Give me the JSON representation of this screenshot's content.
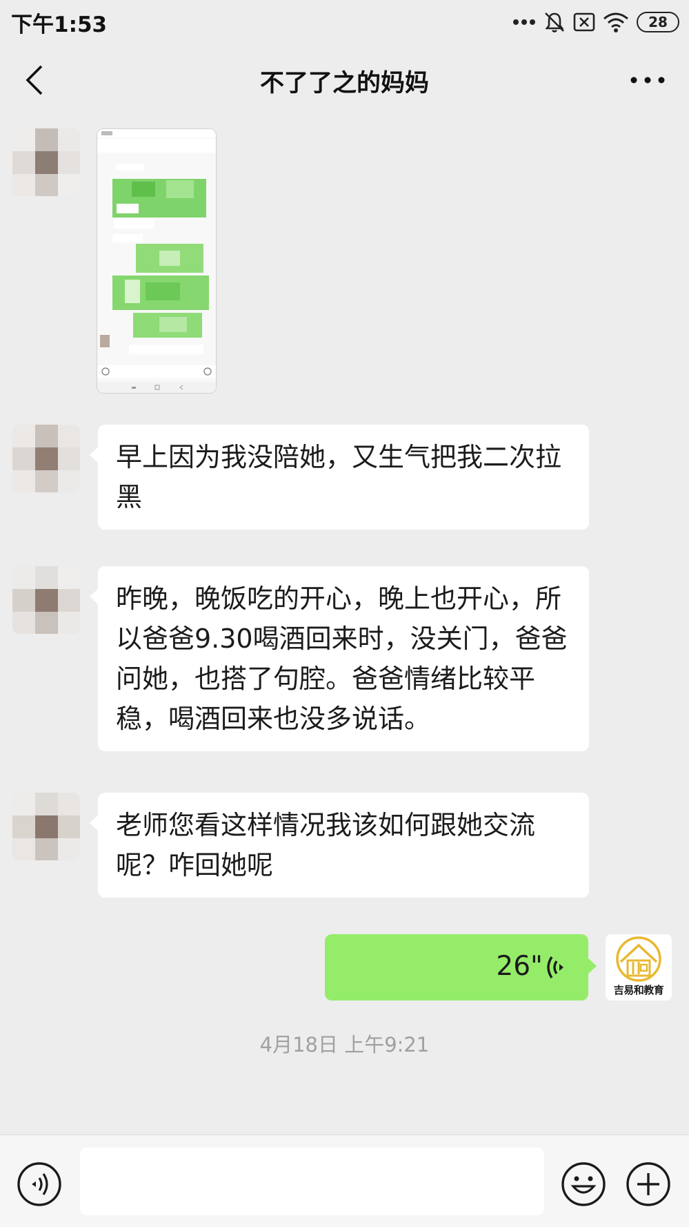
{
  "status_bar": {
    "time": "下午1:53",
    "battery": "28",
    "icons": [
      "more-dots-icon",
      "mute-bell-icon",
      "no-sim-icon",
      "wifi-icon",
      "battery-icon"
    ]
  },
  "header": {
    "title": "不了了之的妈妈",
    "back_icon": "chevron-left-icon",
    "more_icon": "more-horizontal-icon"
  },
  "messages": [
    {
      "side": "left",
      "type": "image"
    },
    {
      "side": "left",
      "type": "text",
      "text": "早上因为我没陪她，又生气把我二次拉黑"
    },
    {
      "side": "left",
      "type": "text",
      "text": "昨晚，晚饭吃的开心，晚上也开心，所以爸爸9.30喝酒回来时，没关门，爸爸问她，也搭了句腔。爸爸情绪比较平稳，喝酒回来也没多说话。"
    },
    {
      "side": "left",
      "type": "text",
      "text": "老师您看这样情况我该如何跟她交流呢？咋回她呢"
    },
    {
      "side": "right",
      "type": "voice",
      "duration": "26\""
    }
  ],
  "my_avatar": {
    "brand": "吉易和教育"
  },
  "timestamp": "4月18日  上午9:21",
  "input_bar": {
    "placeholder": "",
    "icons": [
      "voice-input-icon",
      "emoji-icon",
      "plus-icon"
    ]
  },
  "colors": {
    "background": "#ededed",
    "incoming_bubble": "#ffffff",
    "outgoing_bubble": "#95ec69",
    "timestamp": "#a0a0a0",
    "brand_gold": "#e8b830"
  }
}
